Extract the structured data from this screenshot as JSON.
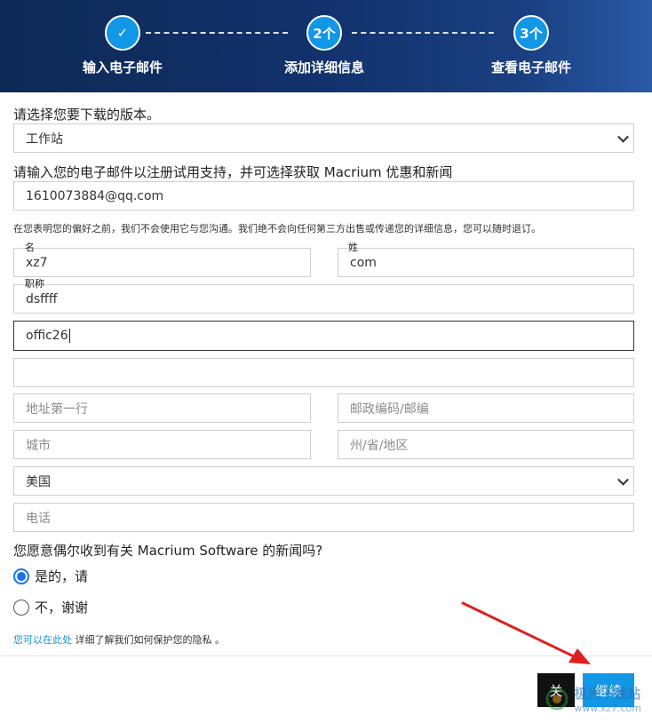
{
  "steps": [
    {
      "badge": "✓",
      "label": "输入电子邮件"
    },
    {
      "badge": "2个",
      "label": "添加详细信息"
    },
    {
      "badge": "3个",
      "label": "查看电子邮件"
    }
  ],
  "form": {
    "version_question": "请选择您要下载的版本。",
    "version_value": "工作站",
    "email_question": "请输入您的电子邮件以注册试用支持，并可选择获取 Macrium 优惠和新闻",
    "email_value": "1610073884@qq.com",
    "privacy_note": "在您表明您的偏好之前，我们不会使用它与您沟通。我们绝不会向任何第三方出售或传递您的详细信息，您可以随时退订。",
    "first_name_label": "名",
    "first_name_value": "xz7",
    "last_name_label": "姓",
    "last_name_value": "com",
    "job_title_label": "职称",
    "job_title_value": "dsffff",
    "company_value": "offic26",
    "blank_value": "",
    "address_placeholder": "地址第一行",
    "postcode_placeholder": "邮政编码/邮编",
    "city_placeholder": "城市",
    "state_placeholder": "州/省/地区",
    "country_value": "美国",
    "phone_placeholder": "电话",
    "news_question": "您愿意偶尔收到有关 Macrium Software 的新闻吗?",
    "radio_yes": "是的，请",
    "radio_no": "不，谢谢",
    "radio_selected": "yes",
    "privacy_link": "您可以在此处",
    "privacy_rest": " 详细了解我们如何保护您的隐私 。"
  },
  "footer": {
    "close_label": "关",
    "continue_label": "继续"
  },
  "colors": {
    "header_dark": "#0d2a55",
    "step_circle": "#1296e6",
    "radio_accent": "#1b73e8",
    "close_button": "#111111",
    "continue_button": "#1296e6",
    "annotation_arrow": "#e02020"
  },
  "watermark": {
    "text": "极光下载站",
    "url": "www.xz7.com"
  }
}
